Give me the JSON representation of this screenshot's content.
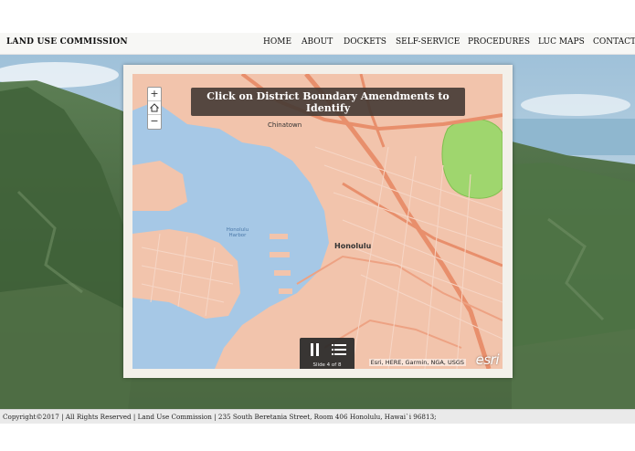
{
  "header": {
    "brand": "LAND USE COMMISSION",
    "nav": [
      "HOME",
      "ABOUT",
      "DOCKETS",
      "SELF-SERVICE",
      "PROCEDURES",
      "LUC MAPS",
      "CONTACT"
    ]
  },
  "map": {
    "banner": "Click on District Boundary Amendments to Identify",
    "zoom_in": "+",
    "zoom_out": "−",
    "labels": {
      "chinatown": "Chinatown",
      "honolulu": "Honolulu",
      "harbor": "Honolulu Harbor"
    },
    "player": {
      "slide_text": "Slide 4 of 8"
    },
    "attribution": "Esri, HERE, Garmin, NGA, USGS",
    "logo": "esri"
  },
  "footer": {
    "text": "Copyright©2017 | All Rights Reserved | Land Use Commission | 235 South Beretania Street, Room 406 Honolulu, Hawai`i 96813;"
  },
  "colors": {
    "water": "#a6c8e6",
    "land": "#f2c4ac",
    "road": "#e88f6c",
    "park": "#9fd66e"
  }
}
